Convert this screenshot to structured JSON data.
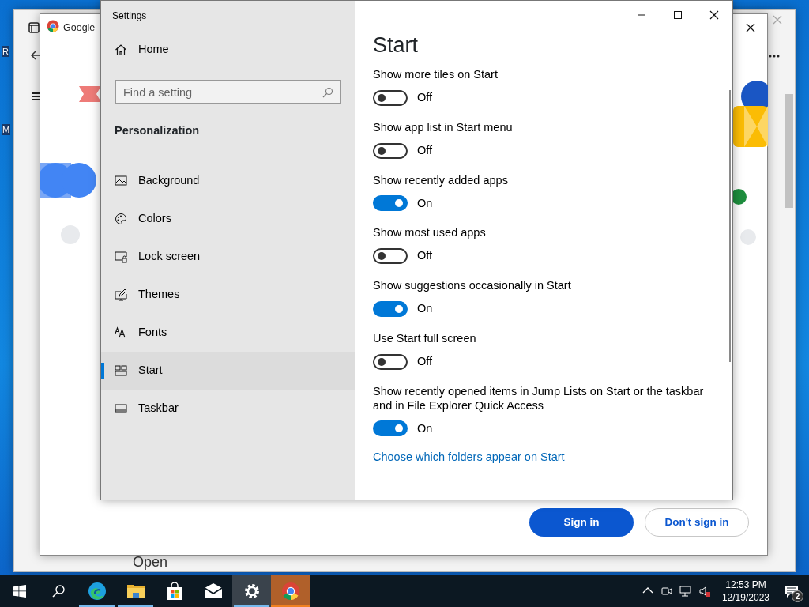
{
  "desktop": {
    "icon_labels": [
      "R",
      "M"
    ]
  },
  "back_window": {
    "text": "Open"
  },
  "chrome_window": {
    "title": "Google",
    "buttons": [
      {
        "label": "Sign in",
        "kind": "primary"
      },
      {
        "label": "Don't sign in",
        "kind": "secondary"
      }
    ]
  },
  "settings": {
    "title": "Settings",
    "home": "Home",
    "search": {
      "placeholder": "Find a setting"
    },
    "section": "Personalization",
    "nav": [
      {
        "label": "Background",
        "selected": false
      },
      {
        "label": "Colors",
        "selected": false
      },
      {
        "label": "Lock screen",
        "selected": false
      },
      {
        "label": "Themes",
        "selected": false
      },
      {
        "label": "Fonts",
        "selected": false
      },
      {
        "label": "Start",
        "selected": true
      },
      {
        "label": "Taskbar",
        "selected": false
      }
    ],
    "heading": "Start",
    "toggles": [
      {
        "label": "Show more tiles on Start",
        "on": false,
        "state_text": "Off"
      },
      {
        "label": "Show app list in Start menu",
        "on": false,
        "state_text": "Off"
      },
      {
        "label": "Show recently added apps",
        "on": true,
        "state_text": "On"
      },
      {
        "label": "Show most used apps",
        "on": false,
        "state_text": "Off"
      },
      {
        "label": "Show suggestions occasionally in Start",
        "on": true,
        "state_text": "On"
      },
      {
        "label": "Use Start full screen",
        "on": false,
        "state_text": "Off"
      },
      {
        "label": "Show recently opened items in Jump Lists on Start or the taskbar and in File Explorer Quick Access",
        "on": true,
        "state_text": "On"
      }
    ],
    "link": "Choose which folders appear on Start"
  },
  "taskbar": {
    "apps": [
      {
        "running": true,
        "selected": false,
        "flashing": false
      },
      {
        "running": true,
        "selected": false,
        "flashing": false
      },
      {
        "running": false,
        "selected": false,
        "flashing": false
      },
      {
        "running": false,
        "selected": false,
        "flashing": false
      },
      {
        "running": true,
        "selected": true,
        "flashing": false
      },
      {
        "running": true,
        "selected": false,
        "flashing": true
      }
    ],
    "time": "12:53 PM",
    "date": "12/19/2023",
    "notifications": "2"
  }
}
